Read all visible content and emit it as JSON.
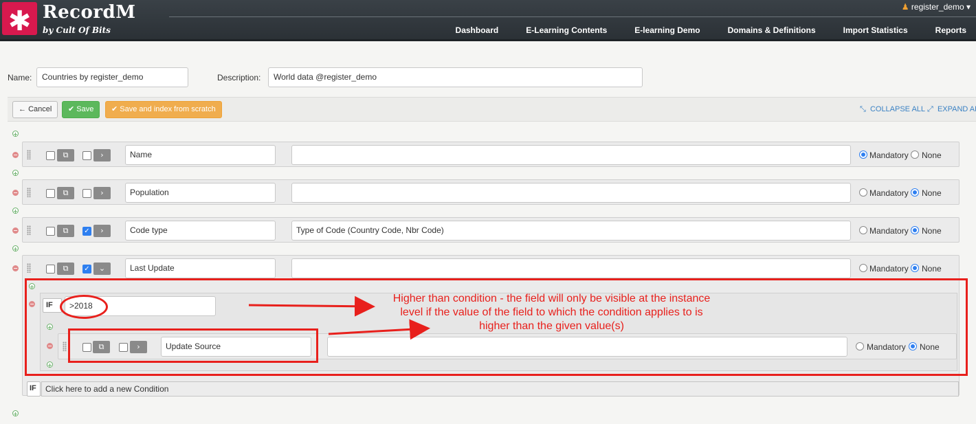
{
  "app": {
    "logo_glyph": "✱",
    "brand": "RecordM",
    "tagline": "by Cult Of Bits",
    "user": "register_demo",
    "nav": [
      "Dashboard",
      "E-Learning Contents",
      "E-learning Demo",
      "Domains & Definitions",
      "Import Statistics",
      "Reports"
    ]
  },
  "form": {
    "name_label": "Name:",
    "name_value": "Countries by register_demo",
    "description_label": "Description:",
    "description_value": "World data @register_demo"
  },
  "toolbar": {
    "cancel": "Cancel",
    "save": "Save",
    "save_index": "Save and index from scratch",
    "collapse_all": "COLLAPSE ALL",
    "expand_all": "EXPAND AL"
  },
  "fields": [
    {
      "name": "Name",
      "description": "",
      "cb2_checked": false,
      "chevron": "›",
      "mandatory": true
    },
    {
      "name": "Population",
      "description": "",
      "cb2_checked": false,
      "chevron": "›",
      "mandatory": false
    },
    {
      "name": "Code type",
      "description": "Type of Code (Country Code, Nbr Code)",
      "cb2_checked": true,
      "chevron": "›",
      "mandatory": false
    },
    {
      "name": "Last Update",
      "description": "",
      "cb2_checked": true,
      "chevron": "⌄",
      "mandatory": false
    }
  ],
  "radio_labels": {
    "mandatory": "Mandatory",
    "none": "None"
  },
  "condition": {
    "if_label": "IF",
    "value": ">2018",
    "sub_field": {
      "name": "Update Source",
      "description": "",
      "mandatory": false
    }
  },
  "annotation": {
    "lines": [
      "Higher than condition - the field will only be visible at the instance",
      "level if the value of the field to which the condition applies to is",
      "higher than the given value(s)"
    ],
    "color": "#e8201c"
  },
  "add_condition": {
    "if_label": "IF",
    "text": "Click here to add a new Condition"
  },
  "colors": {
    "header": "#2b3136",
    "logo": "#d8194e",
    "save": "#5cb85c",
    "save_index": "#f0ad4e",
    "link": "#3b82c4",
    "checkbox_on": "#2e7ff0"
  }
}
